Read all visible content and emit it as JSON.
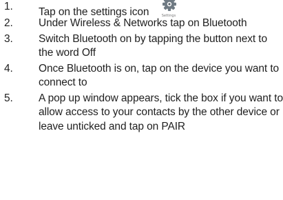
{
  "steps": [
    {
      "number": "1.",
      "text": "Tap on the settings icon"
    },
    {
      "number": "2.",
      "text": "Under Wireless & Networks tap on Bluetooth"
    },
    {
      "number": "3.",
      "text": "Switch Bluetooth on by tapping the button next to the word Off"
    },
    {
      "number": "4.",
      "text": "Once Bluetooth is on, tap on the device you want to connect to"
    },
    {
      "number": "5.",
      "text": "A pop up window appears, tick the box if you want to allow access to your contacts by the other device or leave unticked and tap on PAIR"
    }
  ],
  "settings_icon": {
    "name": "settings-gear-icon",
    "caption": "Settings"
  }
}
